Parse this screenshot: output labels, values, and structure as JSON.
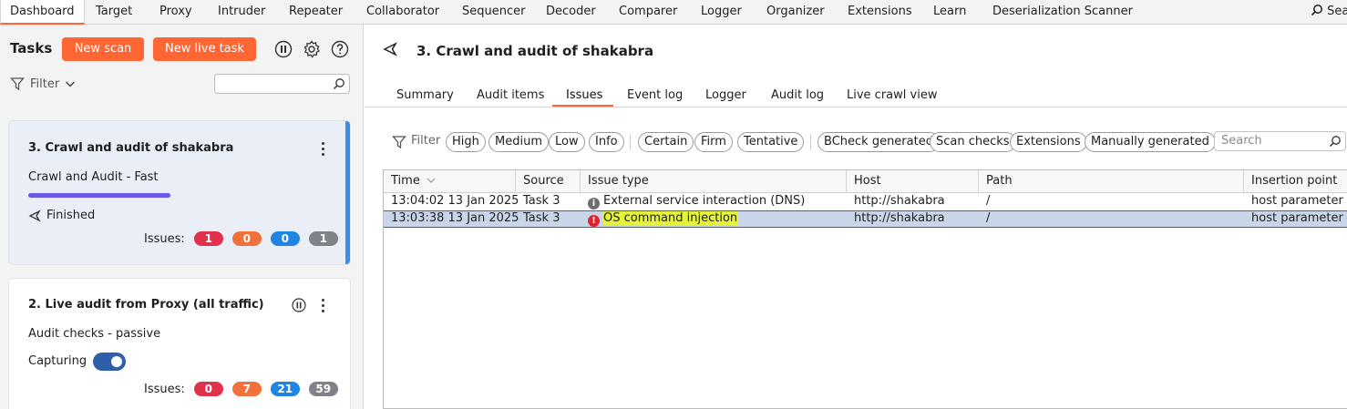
{
  "menu": {
    "tabs": [
      "Dashboard",
      "Target",
      "Proxy",
      "Intruder",
      "Repeater",
      "Collaborator",
      "Sequencer",
      "Decoder",
      "Comparer",
      "Logger",
      "Organizer",
      "Extensions",
      "Learn",
      "Deserialization Scanner"
    ],
    "active": "Dashboard",
    "search_label": "Sea"
  },
  "left": {
    "title": "Tasks",
    "new_scan": "New scan",
    "new_live_task": "New live task",
    "filter_label": "Filter",
    "search_value": ""
  },
  "tasks": [
    {
      "title": "3. Crawl and audit of shakabra",
      "subtitle": "Crawl and Audit - Fast",
      "status": "Finished",
      "progress": 1.0,
      "issues_label": "Issues:",
      "issues": {
        "high": "1",
        "medium": "0",
        "low": "0",
        "info": "1"
      }
    },
    {
      "title": "2. Live audit from Proxy (all traffic)",
      "subtitle": "Audit checks - passive",
      "status": "Capturing",
      "toggle_on": true,
      "issues_label": "Issues:",
      "issues": {
        "high": "0",
        "medium": "7",
        "low": "21",
        "info": "59"
      }
    }
  ],
  "detail": {
    "heading": "3. Crawl and audit of shakabra",
    "tabs": [
      "Summary",
      "Audit items",
      "Issues",
      "Event log",
      "Logger",
      "Audit log",
      "Live crawl view"
    ],
    "active_tab": "Issues",
    "filter_label": "Filter",
    "chips_severity": [
      "High",
      "Medium",
      "Low",
      "Info"
    ],
    "chips_confidence": [
      "Certain",
      "Firm",
      "Tentative"
    ],
    "chips_source": [
      "BCheck generated",
      "Scan checks",
      "Extensions",
      "Manually generated"
    ],
    "search_placeholder": "Search",
    "columns": [
      "Time",
      "Source",
      "Issue type",
      "Host",
      "Path",
      "Insertion point"
    ],
    "rows": [
      {
        "time": "13:04:02 13 Jan 2025",
        "source": "Task 3",
        "severity": "info",
        "issue": "External service interaction (DNS)",
        "host": "http://shakabra",
        "path": "/",
        "insertion": "host parameter"
      },
      {
        "time": "13:03:38 13 Jan 2025",
        "source": "Task 3",
        "severity": "high",
        "issue": "OS command injection",
        "host": "http://shakabra",
        "path": "/",
        "insertion": "host parameter"
      }
    ]
  },
  "colors": {
    "accent": "#ff6633",
    "high": "#e0324a",
    "medium": "#f2703a",
    "low": "#1e86e2",
    "info": "#7f8288",
    "selection": "#c9d6ea"
  }
}
